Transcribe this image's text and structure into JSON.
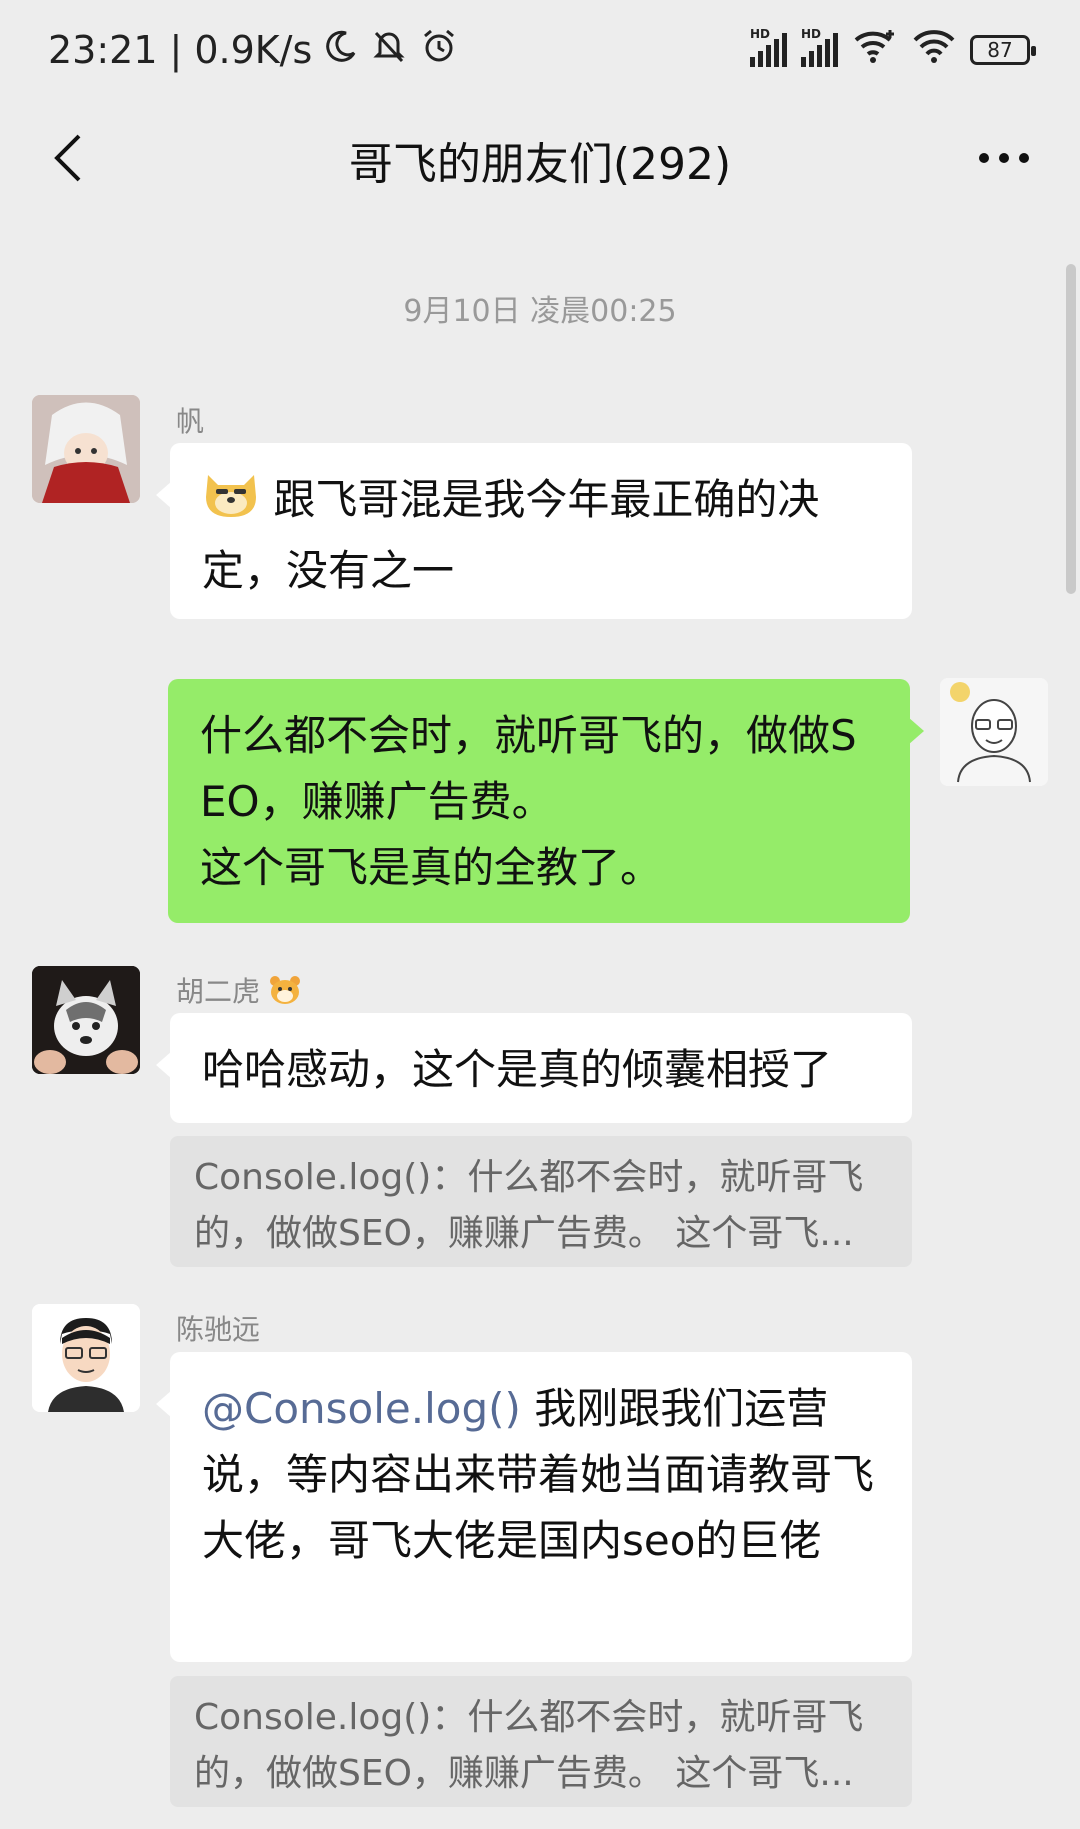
{
  "status_bar": {
    "time": "23:21",
    "net_speed": "0.9K/s",
    "signal1_label": "HD",
    "signal2_label": "HD",
    "battery": "87"
  },
  "nav": {
    "title": "哥飞的朋友们(292)"
  },
  "timestamp": "9月10日 凌晨00:25",
  "messages": [
    {
      "sender": "帆",
      "text": "跟飞哥混是我今年最正确的决定，没有之一"
    },
    {
      "sender": "",
      "text_line1": "什么都不会时，就听哥飞的，做做SEO，赚赚广告费。",
      "text_line2": "这个哥飞是真的全教了。"
    },
    {
      "sender": "胡二虎",
      "text": "哈哈感动，这个是真的倾囊相授了",
      "quote": "Console.log()：什么都不会时，就听哥飞的，做做SEO，赚赚广告费。 这个哥飞..."
    },
    {
      "sender": "陈驰远",
      "mention": "@Console.log()",
      "text": " 我刚跟我们运营说，等内容出来带着她当面请教哥飞大佬，哥飞大佬是国内seo的巨佬",
      "quote": "Console.log()：什么都不会时，就听哥飞的，做做SEO，赚赚广告费。 这个哥飞..."
    }
  ]
}
